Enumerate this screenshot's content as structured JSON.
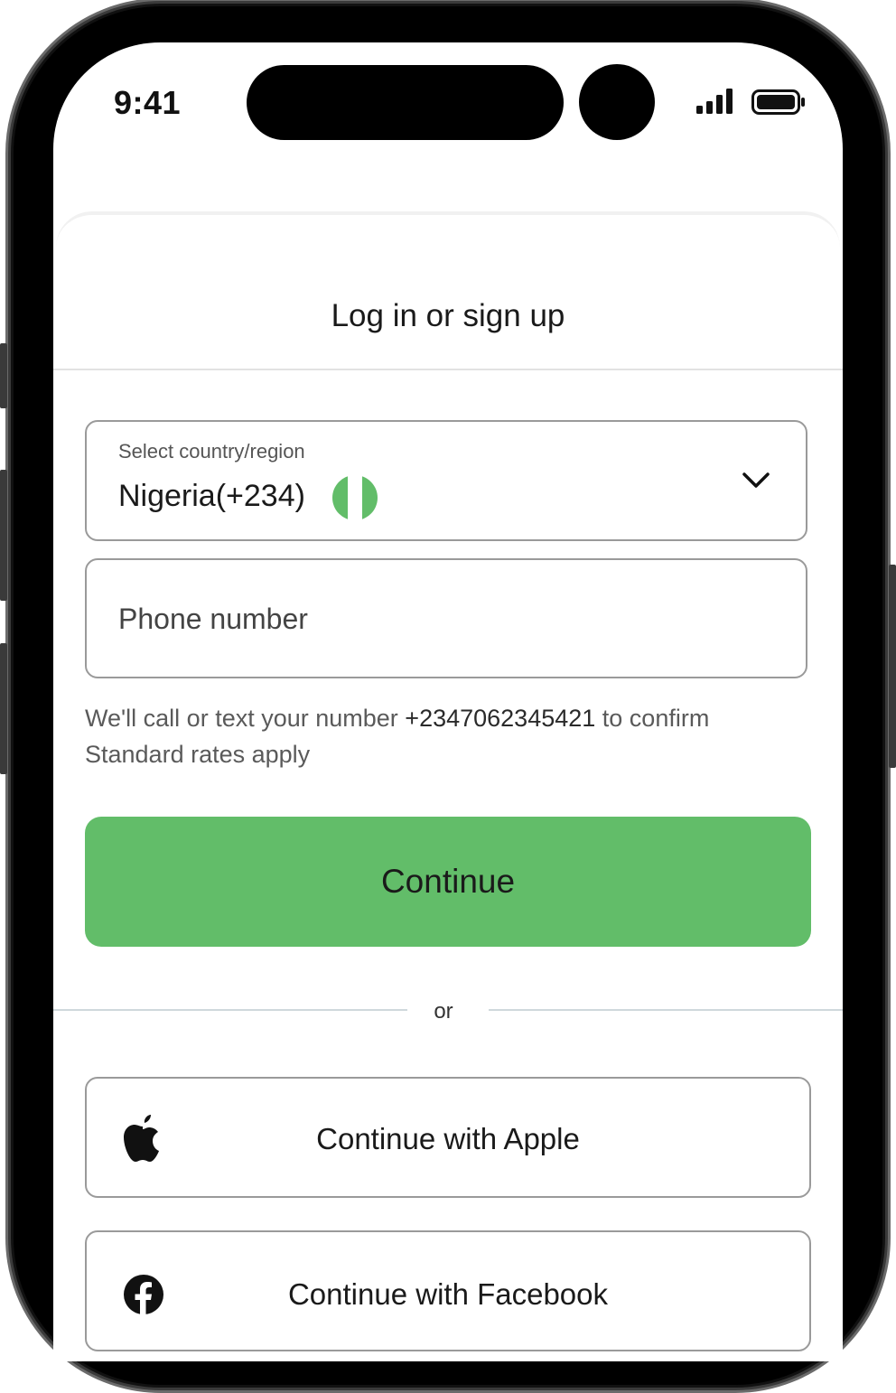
{
  "status_bar": {
    "time": "9:41",
    "icons": [
      "signal-icon",
      "battery-icon"
    ]
  },
  "sheet": {
    "title": "Log in or sign up"
  },
  "country_select": {
    "caption": "Select country/region",
    "value": "Nigeria(+234)",
    "flag": "nigeria-flag-icon",
    "flag_colors": [
      "#62bd69",
      "#ffffff",
      "#62bd69"
    ],
    "chevron": "chevron-down-icon"
  },
  "phone_field": {
    "placeholder": "Phone number"
  },
  "helper": {
    "line1_prefix": "We'll call or text your number ",
    "line1_number": "+2347062345421",
    "line1_suffix": " to confirm",
    "line2": "Standard rates apply"
  },
  "continue_button": {
    "label": "Continue",
    "color": "#62bd69"
  },
  "divider": {
    "label": "or"
  },
  "social": {
    "apple_label": "Continue with Apple",
    "facebook_label": "Continue with Facebook"
  }
}
